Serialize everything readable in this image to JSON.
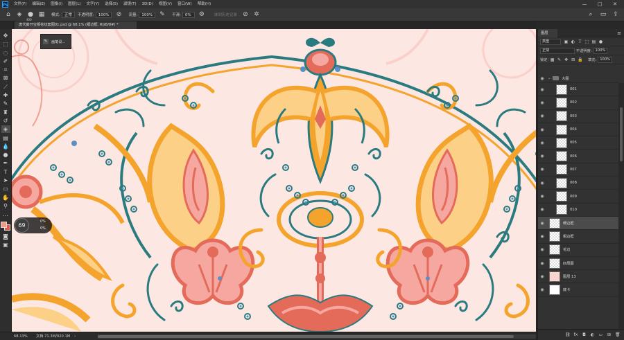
{
  "menubar": {
    "logo": "Ps",
    "items": [
      "文件(F)",
      "编辑(E)",
      "图像(I)",
      "图层(L)",
      "文字(Y)",
      "选择(S)",
      "滤镜(T)",
      "3D(D)",
      "视图(V)",
      "窗口(W)",
      "帮助(H)"
    ]
  },
  "options": {
    "brush_size": "400",
    "mode_label": "模式:",
    "mode_value": "正常",
    "opacity_label": "不透明度:",
    "opacity_value": "100%",
    "flow_label": "流量:",
    "flow_value": "100%",
    "smooth_label": "平滑:",
    "smooth_value": "0%",
    "erase_history": "抹到历史记录"
  },
  "tab": {
    "title": "唐代葵开宝相花纹套图01.psd @ 68.1% (细边框, RGB/8#) *"
  },
  "popup": {
    "label": "画笔设..."
  },
  "hud": {
    "size": "69",
    "line1": "0%",
    "line2": "0%"
  },
  "status": {
    "zoom": "68.13%",
    "doc": "文档:71.3M/920.1M"
  },
  "layers_panel": {
    "tab": "图层",
    "kind": "类型",
    "blend": "正常",
    "opacity_label": "不透明度:",
    "opacity_value": "100%",
    "lock_label": "锁定:",
    "fill_label": "填充:",
    "fill_value": "100%",
    "group_name": "大图",
    "layers": [
      "001",
      "002",
      "003",
      "004",
      "005",
      "006",
      "007",
      "008",
      "009",
      "010",
      "细边框",
      "粗边框",
      "花边",
      "四周图",
      "图层 13",
      "底卡"
    ]
  },
  "colors": {
    "canvas_bg": "#fde7e2",
    "teal": "#2a7b7f",
    "orange": "#f4a42c",
    "light_orange": "#fcd087",
    "coral": "#e46a5a",
    "pink": "#f5a7a0",
    "blue": "#5a8fc4"
  }
}
